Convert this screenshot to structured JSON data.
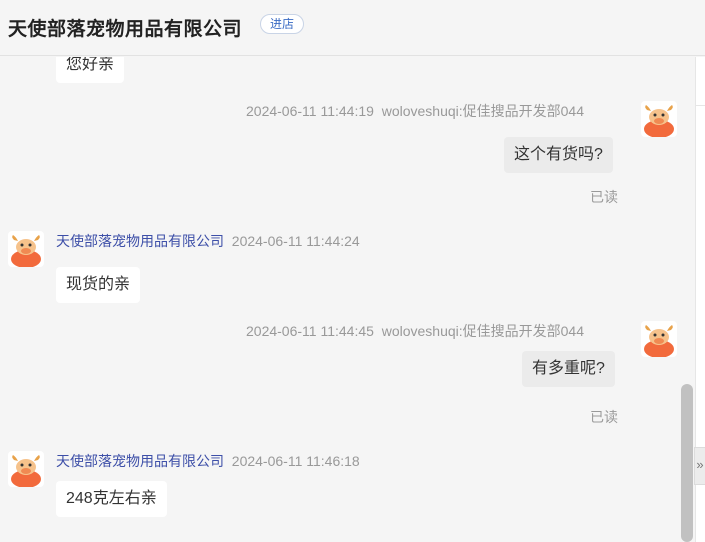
{
  "header": {
    "shop_name": "天使部落宠物用品有限公司",
    "enter_store_label": "进店"
  },
  "messages": [
    {
      "direction": "in",
      "text": "您好亲"
    },
    {
      "direction": "out",
      "timestamp": "2024-06-11 11:44:19",
      "sender": "woloveshuqi:促佳搜品开发部044",
      "text": "这个有货吗?",
      "status": "已读"
    },
    {
      "direction": "in",
      "sender": "天使部落宠物用品有限公司",
      "timestamp": "2024-06-11 11:44:24",
      "text": "现货的亲"
    },
    {
      "direction": "out",
      "timestamp": "2024-06-11 11:44:45",
      "sender": "woloveshuqi:促佳搜品开发部044",
      "text": "有多重呢?",
      "status": "已读"
    },
    {
      "direction": "in",
      "sender": "天使部落宠物用品有限公司",
      "timestamp": "2024-06-11 11:46:18",
      "text": "248克左右亲"
    }
  ],
  "side_panel": {
    "collapse_glyph": "»"
  },
  "colors": {
    "sender_link": "#3d4fa8",
    "meta": "#999999",
    "incoming_bubble": "#ffffff",
    "outgoing_bubble": "#ebebeb",
    "avatar_accent": "#f26a3c"
  },
  "icons": {
    "avatar": "cow-avatar-icon",
    "collapse": "chevron-right-double-icon"
  }
}
